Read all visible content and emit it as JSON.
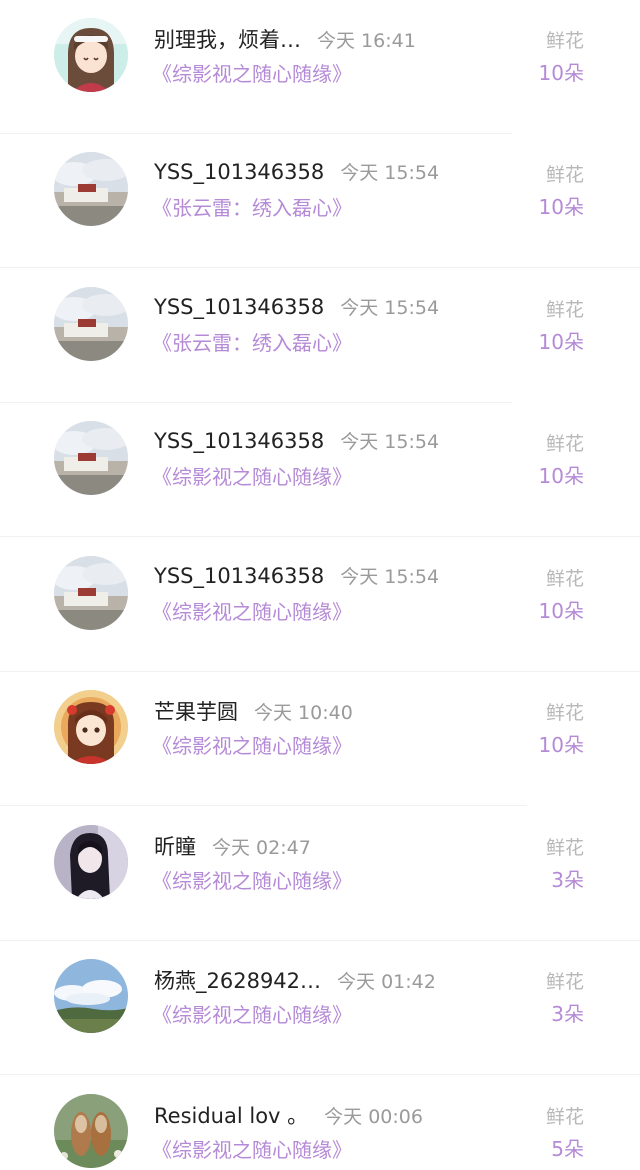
{
  "rows": [
    {
      "name": "别理我，烦着…",
      "time": "今天 16:41",
      "book": "《综影视之随心随缘》",
      "gift_name": "鲜花",
      "gift_count": "10朵",
      "avatar_icon": "anime-girl-avatar"
    },
    {
      "name": "YSS_101346358",
      "time": "今天 15:54",
      "book": "《张云雷：绣入磊心》",
      "gift_name": "鲜花",
      "gift_count": "10朵",
      "avatar_icon": "palace-landscape-avatar"
    },
    {
      "name": "YSS_101346358",
      "time": "今天 15:54",
      "book": "《张云雷：绣入磊心》",
      "gift_name": "鲜花",
      "gift_count": "10朵",
      "avatar_icon": "palace-landscape-avatar"
    },
    {
      "name": "YSS_101346358",
      "time": "今天 15:54",
      "book": "《综影视之随心随缘》",
      "gift_name": "鲜花",
      "gift_count": "10朵",
      "avatar_icon": "palace-landscape-avatar"
    },
    {
      "name": "YSS_101346358",
      "time": "今天 15:54",
      "book": "《综影视之随心随缘》",
      "gift_name": "鲜花",
      "gift_count": "10朵",
      "avatar_icon": "palace-landscape-avatar"
    },
    {
      "name": "芒果芋圆",
      "time": "今天 10:40",
      "book": "《综影视之随心随缘》",
      "gift_name": "鲜花",
      "gift_count": "10朵",
      "avatar_icon": "illustrated-girl-avatar"
    },
    {
      "name": "昕瞳",
      "time": "今天 02:47",
      "book": "《综影视之随心随缘》",
      "gift_name": "鲜花",
      "gift_count": "3朵",
      "avatar_icon": "dark-hair-girl-avatar"
    },
    {
      "name": "杨燕_2628942…",
      "time": "今天 01:42",
      "book": "《综影视之随心随缘》",
      "gift_name": "鲜花",
      "gift_count": "3朵",
      "avatar_icon": "sky-landscape-avatar"
    },
    {
      "name": "Residual lov 。",
      "time": "今天 00:06",
      "book": "《综影视之随心随缘》",
      "gift_name": "鲜花",
      "gift_count": "5朵",
      "avatar_icon": "shoes-photo-avatar"
    }
  ],
  "colors": {
    "accent_purple": "#b58ad6",
    "name_text": "#222222",
    "secondary_text": "#9a9a9a",
    "gift_label": "#b8b8b8",
    "divider": "#f1f1f1"
  }
}
